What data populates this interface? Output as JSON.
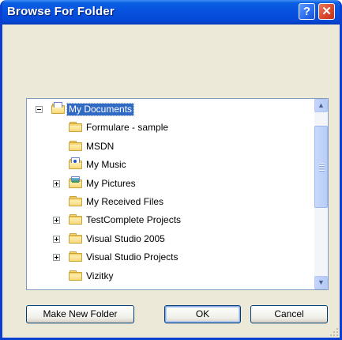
{
  "window": {
    "title": "Browse For Folder",
    "help_glyph": "?",
    "close_glyph": "✕"
  },
  "tree": {
    "items": [
      {
        "label": "My Documents",
        "icon": "documents-folder-icon",
        "expander": "minus",
        "selected": true,
        "level": 0
      },
      {
        "label": "Formulare - sample",
        "icon": "folder-icon",
        "expander": null,
        "level": 1
      },
      {
        "label": "MSDN",
        "icon": "folder-icon",
        "expander": null,
        "level": 1
      },
      {
        "label": "My Music",
        "icon": "music-folder-icon",
        "expander": null,
        "level": 1
      },
      {
        "label": "My Pictures",
        "icon": "pictures-folder-icon",
        "expander": "plus",
        "level": 1
      },
      {
        "label": "My Received Files",
        "icon": "folder-icon",
        "expander": null,
        "level": 1
      },
      {
        "label": "TestComplete Projects",
        "icon": "folder-icon",
        "expander": "plus",
        "level": 1
      },
      {
        "label": "Visual Studio 2005",
        "icon": "folder-icon",
        "expander": "plus",
        "level": 1
      },
      {
        "label": "Visual Studio Projects",
        "icon": "folder-icon",
        "expander": "plus",
        "level": 1
      },
      {
        "label": "Vizitky",
        "icon": "folder-icon",
        "expander": null,
        "level": 1
      }
    ],
    "scroll_up_glyph": "▲",
    "scroll_down_glyph": "▼"
  },
  "buttons": {
    "make_new_folder": "Make New Folder",
    "ok": "OK",
    "cancel": "Cancel"
  },
  "colors": {
    "titlebar": "#0754e0",
    "selection": "#316ac5",
    "dialog_bg": "#ece9d8"
  }
}
